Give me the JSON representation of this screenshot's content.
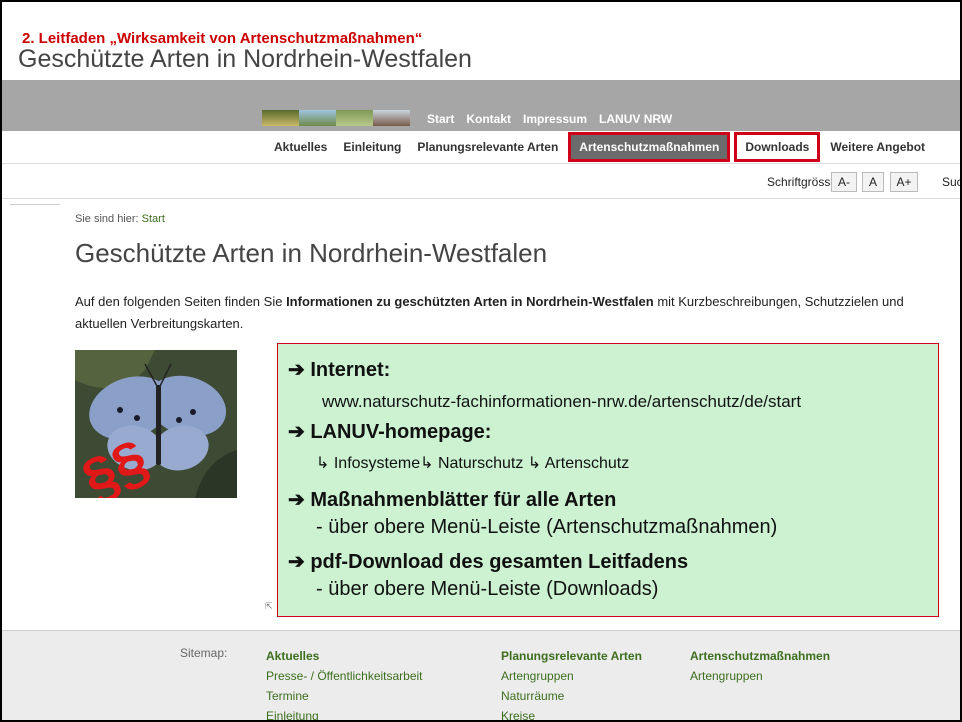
{
  "slide": {
    "heading": "2. Leitfaden „Wirksamkeit von Artenschutzmaßnahmen“",
    "title": "Geschützte Arten in Nordrhein-Westfalen"
  },
  "topnav": [
    "Start",
    "Kontakt",
    "Impressum",
    "LANUV NRW"
  ],
  "mainnav": [
    "Aktuelles",
    "Einleitung",
    "Planungsrelevante Arten",
    "Artenschutzmaßnahmen",
    "Downloads",
    "Weitere Angebot"
  ],
  "fontsize": {
    "label": "Schriftgrösse:",
    "small": "A-",
    "normal": "A",
    "large": "A+",
    "search": "Suc"
  },
  "breadcrumb": {
    "prefix": "Sie sind hier:",
    "current": "Start"
  },
  "page": {
    "heading": "Geschützte Arten in Nordrhein-Westfalen",
    "intro_before": "Auf den folgenden Seiten finden Sie ",
    "intro_bold": "Informationen zu geschützten Arten in Nordrhein-Westfalen",
    "intro_after": " mit Kurzbeschreibungen, Schutzzielen und aktuellen Verbreitungskarten."
  },
  "callout": {
    "h1": "➔ Internet:",
    "url": "www.naturschutz-fachinformationen-nrw.de/artenschutz/de/start",
    "h2": "➔ LANUV-homepage:",
    "path": "↳ Infosysteme↳ Naturschutz ↳ Artenschutz",
    "h3": "➔ Maßnahmenblätter für alle Arten",
    "t3": "- über obere Menü-Leiste (Artenschutzmaßnahmen)",
    "h4": "➔ pdf-Download des gesamten Leitfadens",
    "t4": "- über obere Menü-Leiste (Downloads)"
  },
  "photo": {
    "overlay": "§§"
  },
  "footer": {
    "label": "Sitemap:",
    "col1": {
      "heading": "Aktuelles",
      "links": [
        "Presse- / Öffentlichkeitsarbeit",
        "Termine",
        "Einleitung"
      ]
    },
    "col2": {
      "heading": "Planungsrelevante Arten",
      "links": [
        "Artengruppen",
        "Naturräume",
        "Kreise"
      ]
    },
    "col3": {
      "heading": "Artenschutzmaßnahmen",
      "links": [
        "Artengruppen"
      ]
    }
  },
  "colors": {
    "accent_red": "#d0021b",
    "nav_active": "#6b6b6b",
    "callout_bg": "#ccf2d2",
    "link_green": "#3c6e1e"
  },
  "icons": {
    "external_link": "external-link-icon"
  }
}
